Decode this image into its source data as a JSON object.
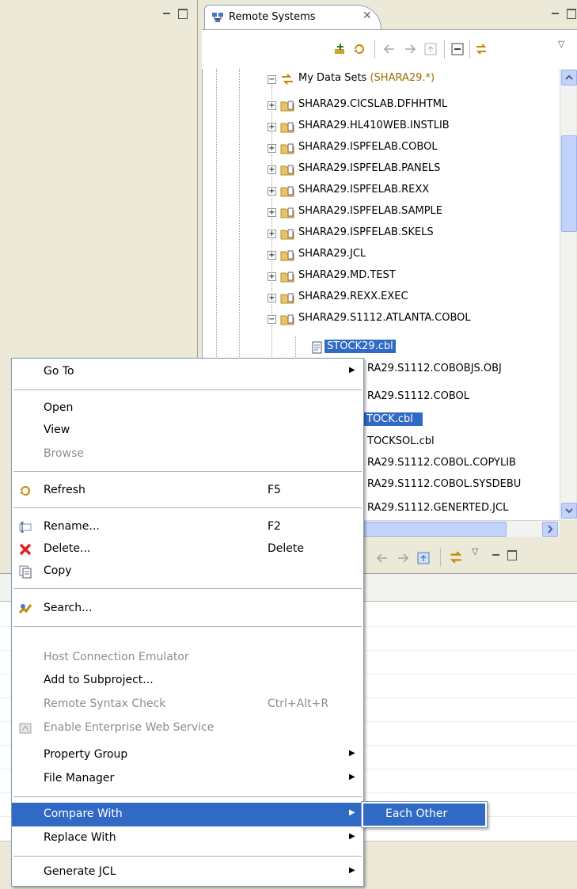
{
  "remote_view": {
    "tab_title": "Remote Systems",
    "tree": [
      {
        "label": "My Data Sets",
        "filter": "(SHARA29.*)",
        "expander": "−"
      },
      {
        "label": "SHARA29.CICSLAB.DFHHTML",
        "expander": "+"
      },
      {
        "label": "SHARA29.HL410WEB.INSTLIB",
        "expander": "+"
      },
      {
        "label": "SHARA29.ISPFELAB.COBOL",
        "expander": "+"
      },
      {
        "label": "SHARA29.ISPFELAB.PANELS",
        "expander": "+"
      },
      {
        "label": "SHARA29.ISPFELAB.REXX",
        "expander": "+"
      },
      {
        "label": "SHARA29.ISPFELAB.SAMPLE",
        "expander": "+"
      },
      {
        "label": "SHARA29.ISPFELAB.SKELS",
        "expander": "+"
      },
      {
        "label": "SHARA29.JCL",
        "expander": "+"
      },
      {
        "label": "SHARA29.MD.TEST",
        "expander": "+"
      },
      {
        "label": "SHARA29.REXX.EXEC",
        "expander": "+"
      },
      {
        "label": "SHARA29.S1112.ATLANTA.COBOL",
        "expander": "−"
      },
      {
        "label": "STOCK29.cbl",
        "selected": true
      },
      {
        "label": "RA29.S1112.COBOBJS.OBJ"
      },
      {
        "label": "RA29.S1112.COBOL"
      },
      {
        "label": "TOCK.cbl",
        "selected": true
      },
      {
        "label": "TOCKSOL.cbl"
      },
      {
        "label": "RA29.S1112.COBOL.COPYLIB"
      },
      {
        "label": "RA29.S1112.COBOL.SYSDEBU"
      },
      {
        "label": "RA29.S1112.GENERTED.JCL"
      }
    ]
  },
  "context_menu": {
    "go_to": "Go To",
    "open": "Open",
    "view": "View",
    "browse": "Browse",
    "refresh": "Refresh",
    "refresh_key": "F5",
    "rename": "Rename...",
    "rename_key": "F2",
    "delete": "Delete...",
    "delete_key": "Delete",
    "copy": "Copy",
    "search": "Search...",
    "host_emulator": "Host Connection Emulator",
    "add_subproject": "Add to Subproject...",
    "syntax_check": "Remote Syntax Check",
    "syntax_check_key": "Ctrl+Alt+R",
    "enable_ws": "Enable Enterprise Web Service",
    "property_group": "Property Group",
    "file_manager": "File Manager",
    "compare_with": "Compare With",
    "replace_with": "Replace With",
    "generate_jcl": "Generate JCL",
    "arrow": "▶"
  },
  "submenu": {
    "each_other": "Each Other"
  },
  "colors": {
    "selection": "#316ac5",
    "filter_text": "#9a6b00"
  }
}
